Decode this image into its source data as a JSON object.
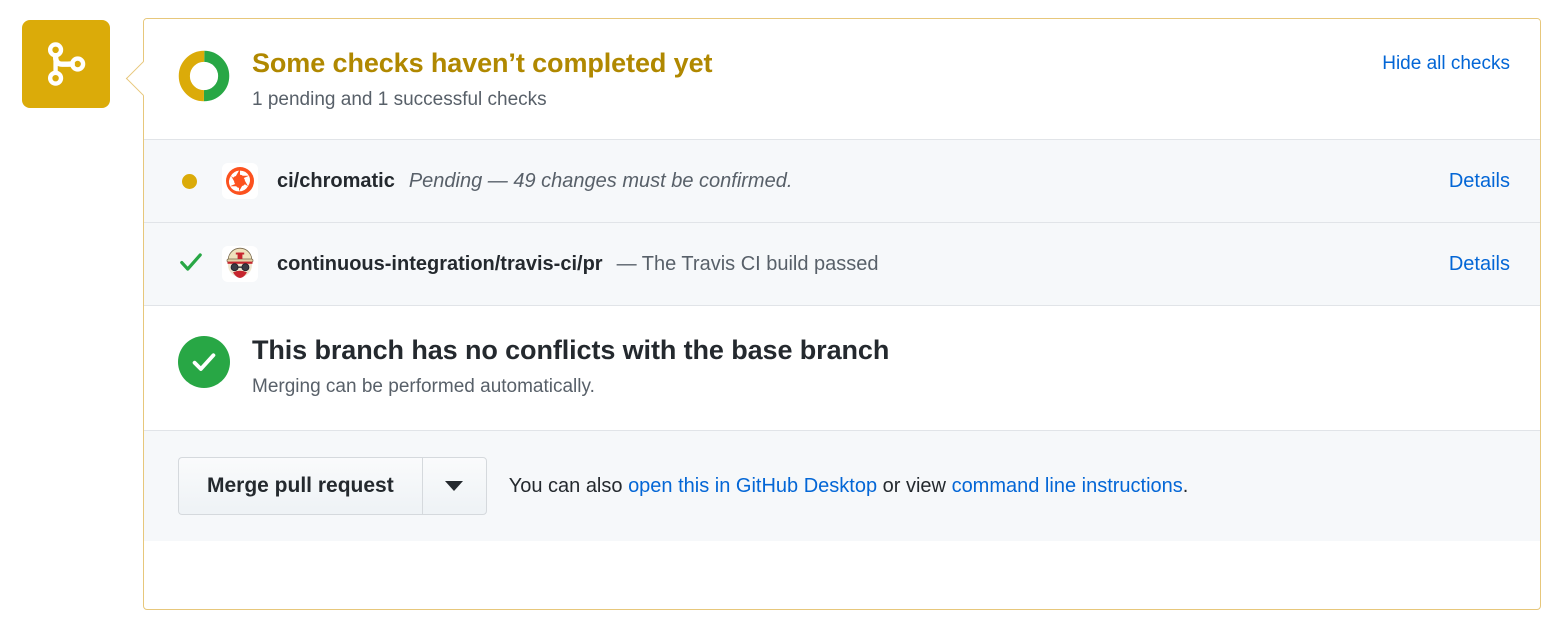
{
  "badge": {
    "icon": "git-merge-icon",
    "color": "#dbab09"
  },
  "header": {
    "title": "Some checks haven’t completed yet",
    "subtitle": "1 pending and 1 successful checks",
    "action_label": "Hide all checks",
    "donut": {
      "pending_color": "#dbab09",
      "success_color": "#28a745",
      "pending_pct": 50,
      "success_pct": 50
    }
  },
  "checks": [
    {
      "status": "pending",
      "status_icon": "yellow-dot-icon",
      "avatar_icon": "chromatic-logo-icon",
      "name": "ci/chromatic",
      "separator": "",
      "description": "Pending — 49 changes must be confirmed.",
      "description_italic": true,
      "details_label": "Details"
    },
    {
      "status": "success",
      "status_icon": "green-check-icon",
      "avatar_icon": "travis-ci-logo-icon",
      "name": "continuous-integration/travis-ci/pr",
      "separator": "",
      "description": "— The Travis CI build passed",
      "description_italic": false,
      "details_label": "Details"
    }
  ],
  "merge_state": {
    "icon": "green-check-circle-icon",
    "title": "This branch has no conflicts with the base branch",
    "subtitle": "Merging can be performed automatically.",
    "color": "#28a745"
  },
  "footer": {
    "merge_button_label": "Merge pull request",
    "dropdown_icon": "chevron-down-icon",
    "text_before": "You can also ",
    "link_desktop": "open this in GitHub Desktop",
    "text_middle": " or view ",
    "link_cli": "command line instructions",
    "text_after": "."
  }
}
